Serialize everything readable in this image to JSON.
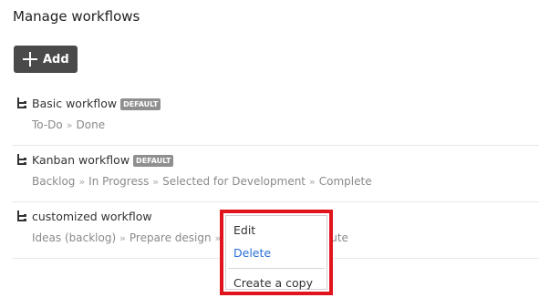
{
  "page": {
    "title": "Manage workflows"
  },
  "toolbar": {
    "add_label": "Add"
  },
  "workflows": [
    {
      "name": "Basic workflow",
      "badge": "DEFAULT",
      "steps": [
        "To-Do",
        "Done"
      ]
    },
    {
      "name": "Kanban workflow",
      "badge": "DEFAULT",
      "steps": [
        "Backlog",
        "In Progress",
        "Selected for Development",
        "Complete"
      ]
    },
    {
      "name": "customized workflow",
      "badge": "",
      "steps": [
        "Ideas (backlog)",
        "Prepare design",
        "",
        "ribute"
      ]
    }
  ],
  "context_menu": {
    "items": [
      "Edit",
      "Delete",
      "Create a copy"
    ],
    "colors": {
      "highlight_border": "#e0141c",
      "delete_text": "#2a6fd6"
    }
  },
  "colors": {
    "add_button_bg": "#4a4a4a",
    "badge_bg": "#8f8f8f"
  }
}
